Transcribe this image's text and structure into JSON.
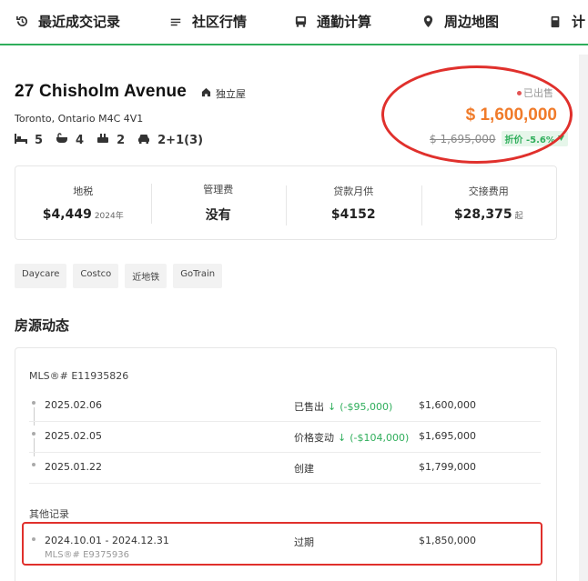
{
  "nav": {
    "items": [
      {
        "label": "最近成交记录",
        "icon": "history-icon"
      },
      {
        "label": "社区行情",
        "icon": "list-icon"
      },
      {
        "label": "通勤计算",
        "icon": "bus-icon"
      },
      {
        "label": "周边地图",
        "icon": "location-pin-icon"
      },
      {
        "label": "计",
        "icon": "calculator-icon"
      }
    ]
  },
  "listing": {
    "address": "27 Chisholm Avenue",
    "property_type": "独立屋",
    "city": "Toronto, Ontario M4C 4V1",
    "specs": [
      {
        "icon": "bed-icon",
        "value": "5"
      },
      {
        "icon": "bath-icon",
        "value": "4"
      },
      {
        "icon": "kitchen-icon",
        "value": "2"
      },
      {
        "icon": "car-icon",
        "value": "2+1(3)"
      }
    ],
    "sold_status": "已出售",
    "price": "$ 1,600,000",
    "original_price": "$ 1,695,000",
    "discount": "折价 -5.6%",
    "accent_color": "#f07b2a",
    "green_color": "#2fae5b"
  },
  "stats": [
    {
      "label": "地税",
      "value": "$4,449",
      "sub": "2024年"
    },
    {
      "label": "管理费",
      "value": "没有",
      "sub": ""
    },
    {
      "label": "贷款月供",
      "value": "$4152",
      "sub": ""
    },
    {
      "label": "交接费用",
      "value": "$28,375",
      "sub": "起"
    }
  ],
  "tags": [
    "Daycare",
    "Costco",
    "近地铁",
    "GoTrain"
  ],
  "history": {
    "title": "房源动态",
    "mls": "MLS®# E11935826",
    "rows": [
      {
        "date": "2025.02.06",
        "status": "已售出",
        "change": "(-$95,000)",
        "amount": "$1,600,000"
      },
      {
        "date": "2025.02.05",
        "status": "价格变动",
        "change": "(-$104,000)",
        "amount": "$1,695,000"
      },
      {
        "date": "2025.01.22",
        "status": "创建",
        "change": "",
        "amount": "$1,799,000"
      }
    ],
    "other_title": "其他记录",
    "other": {
      "date": "2024.10.01 - 2024.12.31",
      "mls": "MLS®# E9375936",
      "status": "过期",
      "amount": "$1,850,000"
    }
  }
}
